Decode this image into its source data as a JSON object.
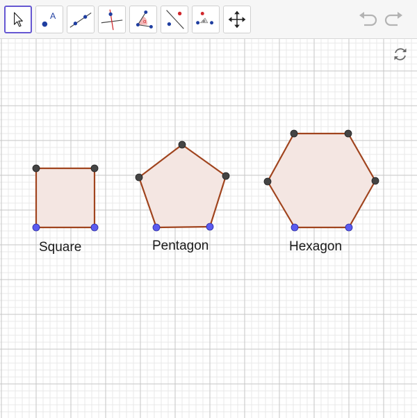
{
  "toolbar": {
    "tools": [
      {
        "name": "move-tool",
        "icon": "arrow-cursor-icon",
        "selected": true
      },
      {
        "name": "point-tool",
        "icon": "point-with-label-icon",
        "label": "A"
      },
      {
        "name": "line-tool",
        "icon": "line-through-two-points-icon"
      },
      {
        "name": "perpendicular-line-tool",
        "icon": "perpendicular-line-icon"
      },
      {
        "name": "angle-tool",
        "icon": "angle-icon",
        "label": "α"
      },
      {
        "name": "reflect-tool",
        "icon": "reflect-about-line-icon"
      },
      {
        "name": "more-tools",
        "icon": "more-tools-icon"
      },
      {
        "name": "move-graphics-view-tool",
        "icon": "move-graphics-view-icon"
      }
    ],
    "undo_icon": "undo-icon",
    "redo_icon": "redo-icon"
  },
  "canvas": {
    "reset_icon": "reset-construction-icon",
    "polygon_fill": "#f4e6e2",
    "polygon_stroke": "#a0441e",
    "vertex_color": "#444444",
    "base_vertex_color": "#5b5bf0",
    "grid_major": "#c6c6c6",
    "grid_minor": "#e9e9e9"
  },
  "shapes": [
    {
      "label": "Square"
    },
    {
      "label": "Pentagon"
    },
    {
      "label": "Hexagon"
    }
  ],
  "colors": {
    "selection": "#6557d2",
    "point_blue": "#1f3ea0",
    "accent_red": "#d0262b"
  }
}
